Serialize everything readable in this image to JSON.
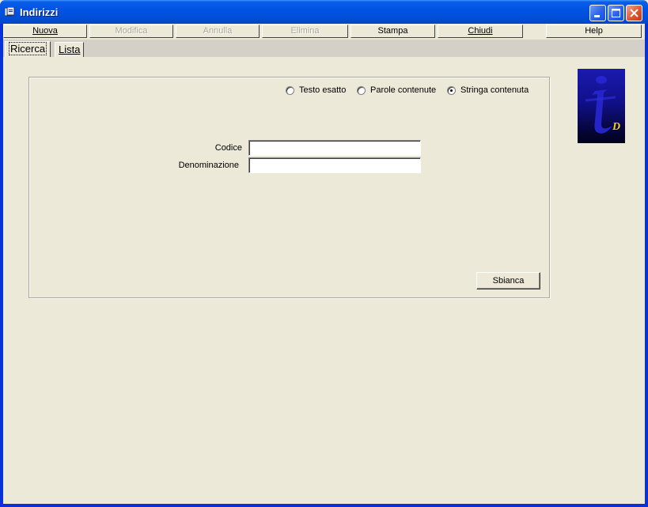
{
  "window": {
    "title": "Indirizzi",
    "controls": {
      "minimize": "minimize-icon",
      "maximize": "maximize-icon",
      "close": "close-icon"
    },
    "accent_color": "#0054e3"
  },
  "toolbar": [
    {
      "id": "nuova",
      "label": "Nuova",
      "enabled": true
    },
    {
      "id": "modifica",
      "label": "Modifica",
      "enabled": false
    },
    {
      "id": "annulla",
      "label": "Annulla",
      "enabled": false
    },
    {
      "id": "elimina",
      "label": "Elimina",
      "enabled": false
    },
    {
      "id": "stampa",
      "label": "Stampa",
      "enabled": true
    },
    {
      "id": "chiudi",
      "label": "Chiudi",
      "enabled": true
    },
    {
      "id": "help",
      "label": "Help",
      "enabled": true
    }
  ],
  "tabs": [
    {
      "label": "Ricerca",
      "active": true
    },
    {
      "label": "Lista",
      "active": false
    }
  ],
  "search": {
    "modes": [
      {
        "label": "Testo esatto",
        "selected": false
      },
      {
        "label": "Parole contenute",
        "selected": false
      },
      {
        "label": "Stringa contenuta",
        "selected": true
      }
    ],
    "fields": [
      {
        "label": "Codice",
        "value": ""
      },
      {
        "label": "Denominazione",
        "value": ""
      }
    ],
    "clear_button": "Sbianca"
  },
  "logo": {
    "icon": "info-logo-icon",
    "text": "D"
  }
}
